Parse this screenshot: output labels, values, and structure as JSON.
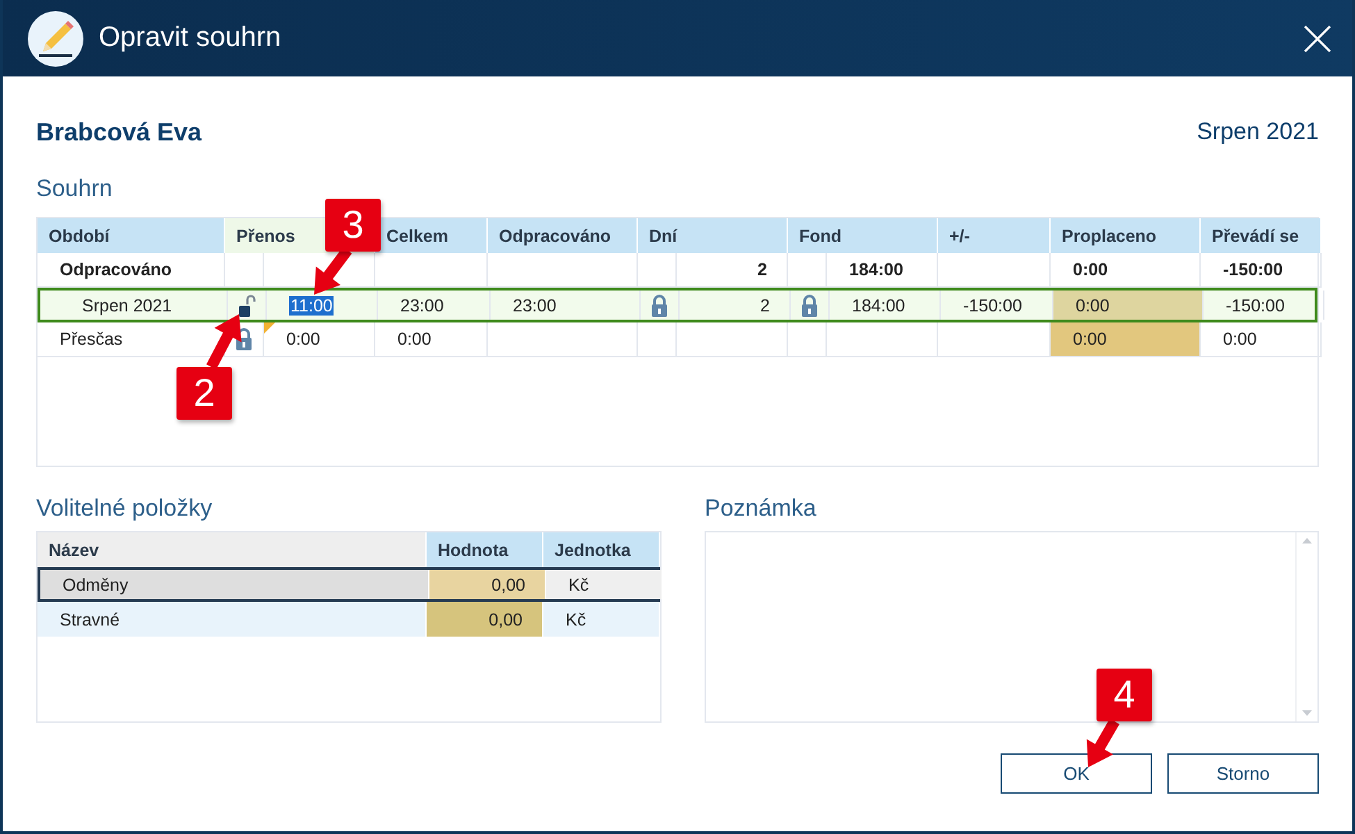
{
  "window": {
    "title": "Opravit souhrn"
  },
  "employee": "Brabcová Eva",
  "period": "Srpen 2021",
  "summary": {
    "title": "Souhrn",
    "columns": [
      "Období",
      "Přenos",
      "Celkem",
      "Odpracováno",
      "Dní",
      "Fond",
      "+/-",
      "Proplaceno",
      "Převádí se"
    ],
    "rows": [
      {
        "kind": "total",
        "selected": false,
        "period": "Odpracováno",
        "days": "2",
        "fund": "184:00",
        "paid": "0:00",
        "paid_editable": false,
        "carried": "-150:00"
      },
      {
        "kind": "detail",
        "selected": true,
        "period": "Srpen 2021",
        "transfer_lock": {
          "locked": false
        },
        "transfer": "11:00",
        "transfer_text_selected": true,
        "transfer_modified": false,
        "total": "23:00",
        "worked": "23:00",
        "days_lock": {
          "locked": true
        },
        "days": "2",
        "fund_lock": {
          "locked": true
        },
        "fund": "184:00",
        "diff": "-150:00",
        "paid": "0:00",
        "paid_editable": true,
        "carried": "-150:00"
      },
      {
        "kind": "plain",
        "selected": false,
        "period": "Přesčas",
        "transfer_lock": {
          "locked": true
        },
        "transfer": "0:00",
        "transfer_text_selected": false,
        "transfer_modified": true,
        "total": "0:00",
        "paid": "0:00",
        "paid_editable": true,
        "carried": "0:00"
      }
    ]
  },
  "optional_items": {
    "title": "Volitelné položky",
    "columns": [
      "Název",
      "Hodnota",
      "Jednotka"
    ],
    "rows": [
      {
        "name": "Odměny",
        "value": "0,00",
        "unit": "Kč",
        "selected": true
      },
      {
        "name": "Stravné",
        "value": "0,00",
        "unit": "Kč",
        "selected": false
      }
    ]
  },
  "note": {
    "title": "Poznámka"
  },
  "buttons": [
    {
      "label": "OK"
    },
    {
      "label": "Storno"
    }
  ],
  "callouts": [
    {
      "label": "3"
    },
    {
      "label": "2"
    },
    {
      "label": "4"
    }
  ]
}
